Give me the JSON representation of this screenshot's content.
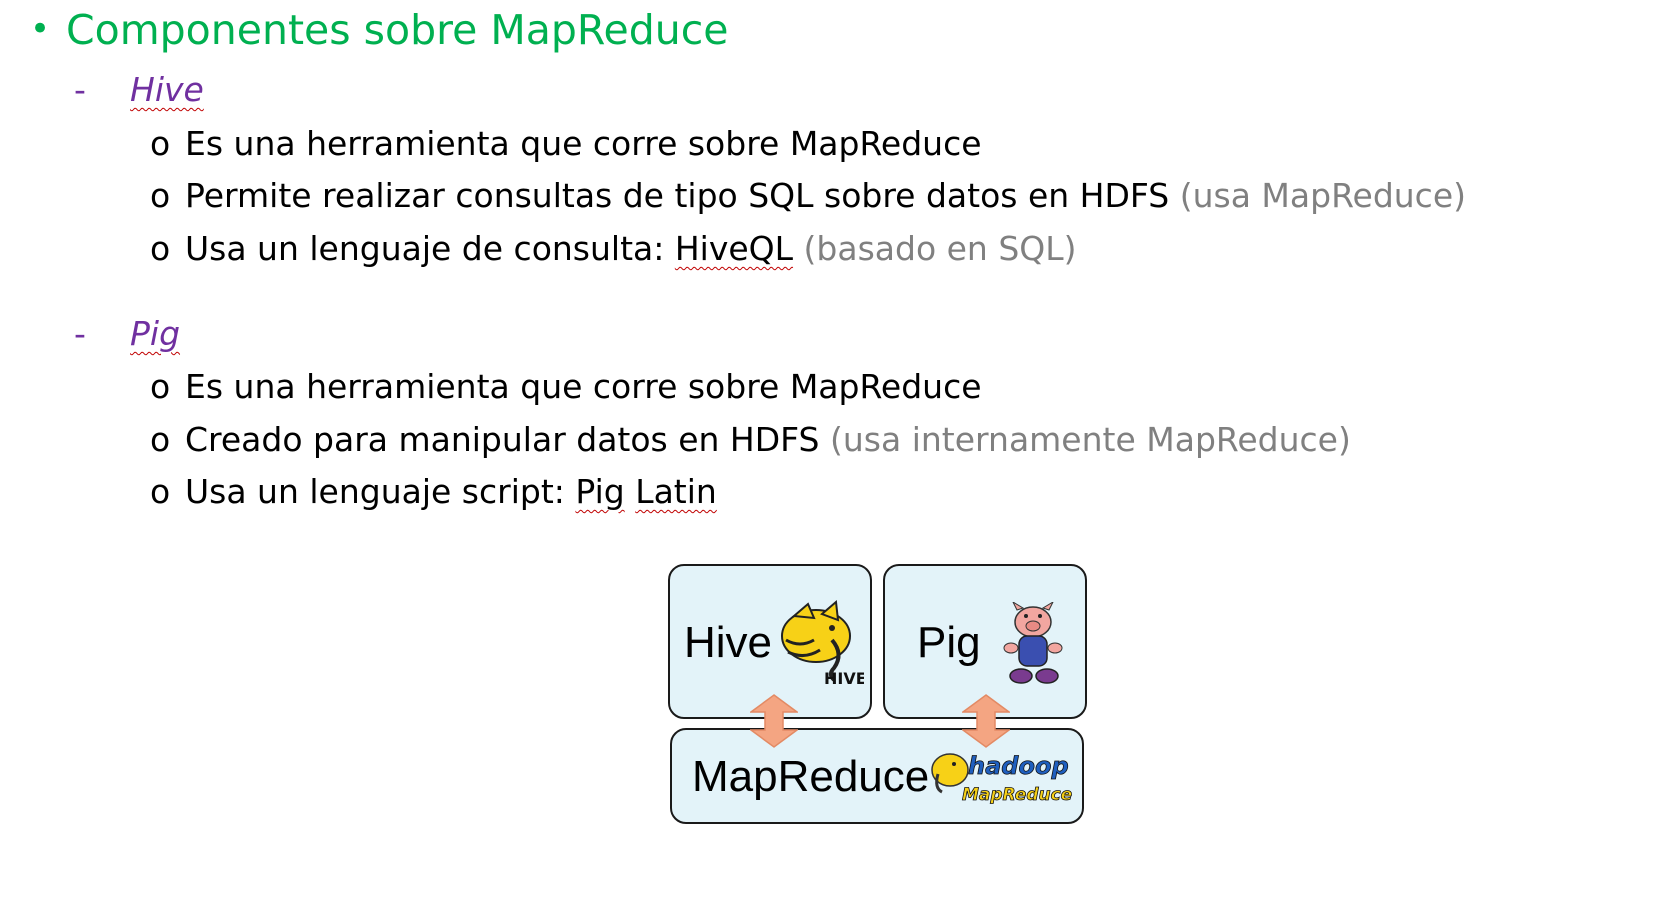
{
  "heading": {
    "bullet": "•",
    "title": "Componentes sobre MapReduce"
  },
  "sections": [
    {
      "dash": "-",
      "name": "Hive",
      "items": [
        {
          "marker": "o",
          "text": "Es una herramienta que corre sobre MapReduce",
          "note": ""
        },
        {
          "marker": "o",
          "text": "Permite realizar consultas de tipo SQL sobre datos en HDFS",
          "note": "(usa MapReduce)"
        },
        {
          "marker": "o",
          "text_before": "Usa un lenguaje de consulta: ",
          "term": "HiveQL",
          "note": "(basado en SQL)"
        }
      ]
    },
    {
      "dash": "-",
      "name": "Pig",
      "items": [
        {
          "marker": "o",
          "text": "Es una herramienta que corre sobre MapReduce",
          "note": ""
        },
        {
          "marker": "o",
          "text": "Creado para manipular datos en HDFS",
          "note": "(usa internamente MapReduce)"
        },
        {
          "marker": "o",
          "text_before": "Usa un lenguaje script: ",
          "term_1": "Pig",
          "term_2": "Latin"
        }
      ]
    }
  ],
  "diagram": {
    "hive_label": "Hive",
    "pig_label": "Pig",
    "mapreduce_label": "MapReduce",
    "hive_logo_text": "HIVE",
    "hadoop_logo_line1": "hadoop",
    "hadoop_logo_line2": "MapReduce",
    "box_fill": "#e3f3f9",
    "arrow_fill": "#f4a582"
  },
  "colors": {
    "heading": "#00b050",
    "section_name": "#7030a0",
    "note": "#808080"
  }
}
